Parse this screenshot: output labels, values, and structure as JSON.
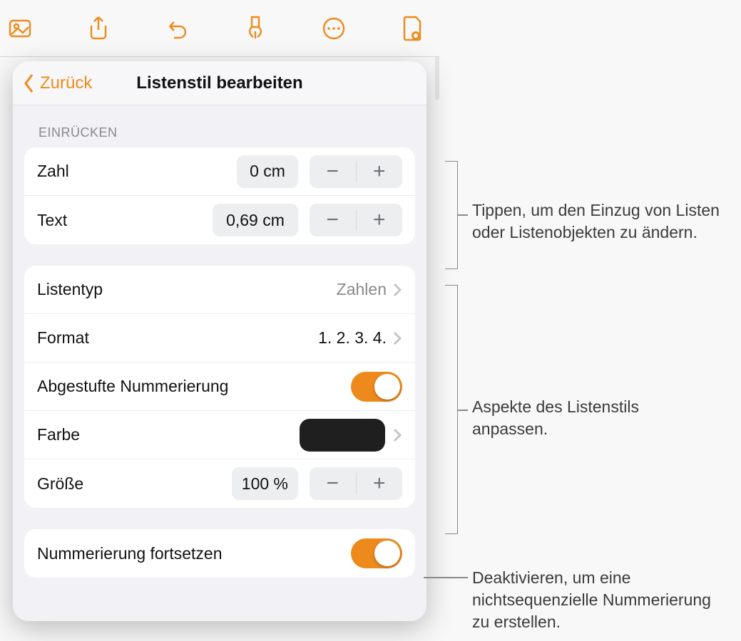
{
  "toolbar": {
    "icons": [
      "media",
      "share",
      "undo",
      "format-brush",
      "more",
      "document-options"
    ]
  },
  "popover": {
    "back_label": "Zurück",
    "title": "Listenstil bearbeiten",
    "section_indent_label": "Einrücken",
    "indent": {
      "number_label": "Zahl",
      "number_value": "0 cm",
      "text_label": "Text",
      "text_value": "0,69 cm"
    },
    "listtype_label": "Listentyp",
    "listtype_value": "Zahlen",
    "format_label": "Format",
    "format_value": "1. 2. 3. 4.",
    "tiered_label": "Abgestufte Nummerierung",
    "tiered_on": true,
    "color_label": "Farbe",
    "color_value": "#1f1f1f",
    "size_label": "Größe",
    "size_value": "100 %",
    "continue_label": "Nummerierung fortsetzen",
    "continue_on": true
  },
  "callouts": {
    "c1": "Tippen, um den Einzug von Listen oder Listenobjekten zu ändern.",
    "c2": "Aspekte des Listenstils anpassen.",
    "c3": "Deaktivieren, um eine nichtsequenzielle Nummerierung zu erstellen."
  }
}
